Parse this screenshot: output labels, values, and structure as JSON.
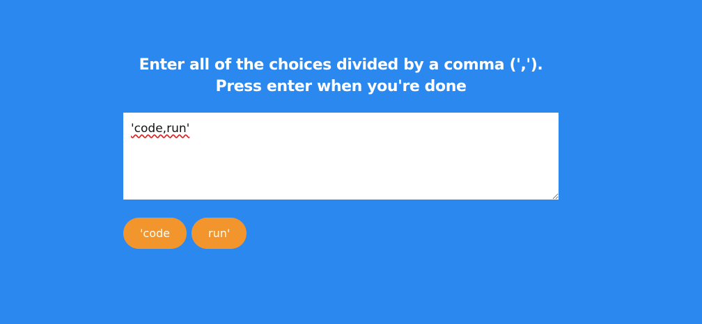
{
  "prompt": {
    "line1": "Enter all of the choices divided by a comma (',').",
    "line2": "Press enter when you're done"
  },
  "input": {
    "value": "'code,run'"
  },
  "choices": [
    {
      "label": "'code"
    },
    {
      "label": "run'"
    }
  ],
  "colors": {
    "background": "#2b88ef",
    "chip": "#f2952d",
    "text": "#ffffff"
  }
}
